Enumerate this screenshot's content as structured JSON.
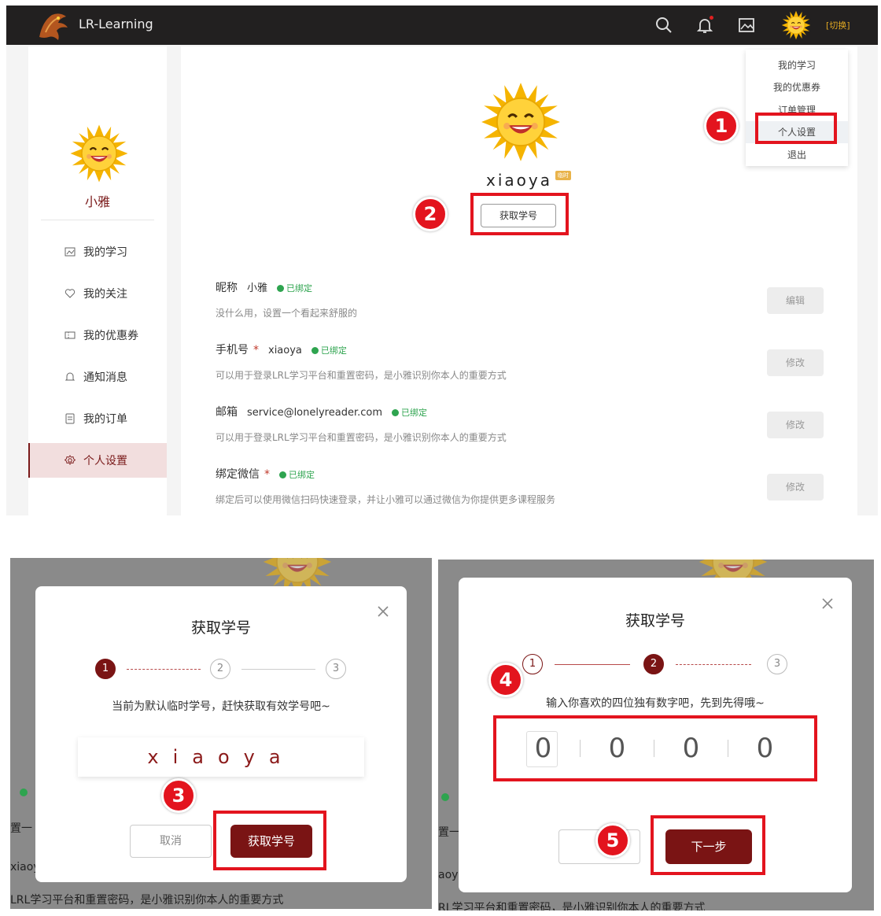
{
  "top": {
    "brand": "LR-Learning",
    "switch_label": "[切换]",
    "icons": [
      "search-icon",
      "bell-icon",
      "image-icon"
    ],
    "sidebar": {
      "name": "小雅",
      "items": [
        {
          "label": "我的学习",
          "icon": "chart-icon"
        },
        {
          "label": "我的关注",
          "icon": "heart-icon"
        },
        {
          "label": "我的优惠券",
          "icon": "coupon-icon"
        },
        {
          "label": "通知消息",
          "icon": "bell-icon"
        },
        {
          "label": "我的订单",
          "icon": "order-icon"
        },
        {
          "label": "个人设置",
          "icon": "gear-icon",
          "active": true
        }
      ]
    },
    "profile": {
      "username": "xiaoya",
      "badge": "临时",
      "get_id_button": "获取学号"
    },
    "fields": [
      {
        "label": "昵称",
        "value": "小雅",
        "required": false,
        "status": "已绑定",
        "desc": "没什么用，设置一个看起来舒服的",
        "button": "编辑"
      },
      {
        "label": "手机号",
        "value": "xiaoya",
        "required": true,
        "status": "已绑定",
        "desc": "可以用于登录LRL学习平台和重置密码，是小雅识别你本人的重要方式",
        "button": "修改"
      },
      {
        "label": "邮箱",
        "value": "service@lonelyreader.com",
        "required": false,
        "status": "已绑定",
        "desc": "可以用于登录LRL学习平台和重置密码，是小雅识别你本人的重要方式",
        "button": "修改"
      },
      {
        "label": "绑定微信",
        "value": "",
        "required": true,
        "status": "已绑定",
        "desc": "绑定后可以使用微信扫码快速登录，并让小雅可以通过微信为你提供更多课程服务",
        "button": "修改"
      }
    ],
    "required_mark": "*",
    "dropdown": [
      "我的学习",
      "我的优惠券",
      "订单管理",
      "个人设置",
      "退出"
    ]
  },
  "modal1": {
    "title": "获取学号",
    "steps": [
      "1",
      "2",
      "3"
    ],
    "hint": "当前为默认临时学号，赶快获取有效学号吧~",
    "id_text": "xiaoya",
    "cancel": "取消",
    "confirm": "获取学号",
    "bg": {
      "line1": "置一",
      "line2": "xiaoy",
      "line3": "LRL学习平台和重置密码，是小雅识别你本人的重要方式"
    }
  },
  "modal2": {
    "title": "获取学号",
    "steps": [
      "1",
      "2",
      "3"
    ],
    "hint": "输入你喜欢的四位独有数字吧，先到先得哦~",
    "digits": [
      "0",
      "0",
      "0",
      "0"
    ],
    "next": "下一步",
    "bg": {
      "line1": "置一",
      "line2": "aoy",
      "line3": "RL学习平台和重置密码，是小雅识别你本人的重要方式"
    }
  },
  "markers": [
    "1",
    "2",
    "3",
    "4",
    "5"
  ],
  "colors": {
    "accent": "#7a1414",
    "highlight": "#e3141e",
    "bound": "#2ea44f",
    "badge": "#e9b34a"
  }
}
